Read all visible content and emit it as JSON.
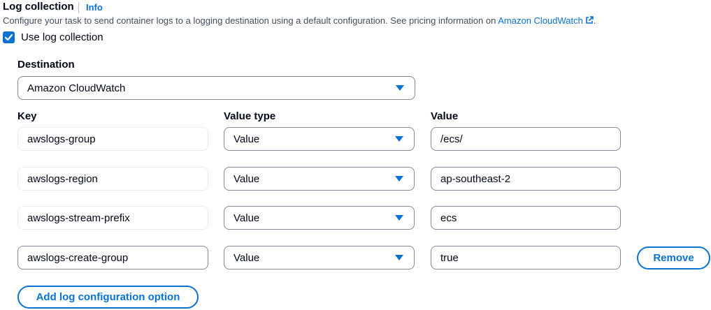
{
  "section": {
    "title": "Log collection",
    "info_label": "Info",
    "description_prefix": "Configure your task to send container logs to a logging destination using a default configuration. See pricing information on ",
    "description_link": "Amazon CloudWatch",
    "description_suffix": "."
  },
  "use_log_collection": {
    "label": "Use log collection",
    "checked": true
  },
  "destination": {
    "label": "Destination",
    "selected": "Amazon CloudWatch"
  },
  "columns": {
    "key": "Key",
    "value_type": "Value type",
    "value": "Value"
  },
  "rows": [
    {
      "key": "awslogs-group",
      "value_type": "Value",
      "value": "/ecs/"
    },
    {
      "key": "awslogs-region",
      "value_type": "Value",
      "value": "ap-southeast-2"
    },
    {
      "key": "awslogs-stream-prefix",
      "value_type": "Value",
      "value": "ecs"
    },
    {
      "key": "awslogs-create-group",
      "value_type": "Value",
      "value": "true"
    }
  ],
  "remove_label": "Remove",
  "add_option_label": "Add log configuration option",
  "colors": {
    "accent": "#0972d3",
    "text": "#000716",
    "secondary_text": "#414d5c",
    "border": "#7d8998"
  },
  "icons": {
    "checkbox": "check-icon",
    "external": "external-link-icon",
    "dropdown": "caret-down-icon"
  }
}
